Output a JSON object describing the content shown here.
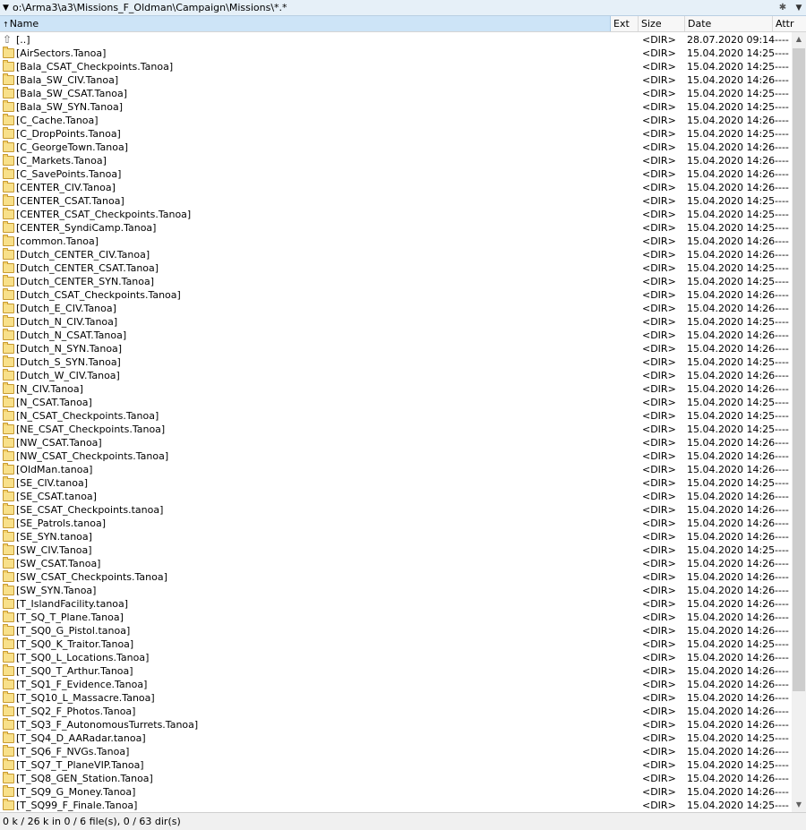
{
  "path_bar": {
    "path": "o:\\Arma3\\a3\\Missions_F_Oldman\\Campaign\\Missions\\*.*",
    "dropdown_icon": "triangle-down",
    "favorites_icon": "star",
    "history_icon": "chevron-down"
  },
  "columns": {
    "name": "Name",
    "ext": "Ext",
    "size": "Size",
    "date": "Date",
    "attr": "Attr",
    "sort_icon": "sort-arrow-up"
  },
  "colors": {
    "path_bar_bg": "#e6f0f8",
    "sorted_header_bg": "#cde4f7",
    "folder_fill": "#f8e08a"
  },
  "files": [
    {
      "name": "[..]",
      "size": "<DIR>",
      "date": "28.07.2020 09:14",
      "attr": "----",
      "icon": "up-dir"
    },
    {
      "name": "[AirSectors.Tanoa]",
      "size": "<DIR>",
      "date": "15.04.2020 14:25",
      "attr": "----",
      "icon": "folder"
    },
    {
      "name": "[Bala_CSAT_Checkpoints.Tanoa]",
      "size": "<DIR>",
      "date": "15.04.2020 14:25",
      "attr": "----",
      "icon": "folder"
    },
    {
      "name": "[Bala_SW_CIV.Tanoa]",
      "size": "<DIR>",
      "date": "15.04.2020 14:26",
      "attr": "----",
      "icon": "folder"
    },
    {
      "name": "[Bala_SW_CSAT.Tanoa]",
      "size": "<DIR>",
      "date": "15.04.2020 14:25",
      "attr": "----",
      "icon": "folder"
    },
    {
      "name": "[Bala_SW_SYN.Tanoa]",
      "size": "<DIR>",
      "date": "15.04.2020 14:25",
      "attr": "----",
      "icon": "folder"
    },
    {
      "name": "[C_Cache.Tanoa]",
      "size": "<DIR>",
      "date": "15.04.2020 14:26",
      "attr": "----",
      "icon": "folder"
    },
    {
      "name": "[C_DropPoints.Tanoa]",
      "size": "<DIR>",
      "date": "15.04.2020 14:25",
      "attr": "----",
      "icon": "folder"
    },
    {
      "name": "[C_GeorgeTown.Tanoa]",
      "size": "<DIR>",
      "date": "15.04.2020 14:26",
      "attr": "----",
      "icon": "folder"
    },
    {
      "name": "[C_Markets.Tanoa]",
      "size": "<DIR>",
      "date": "15.04.2020 14:26",
      "attr": "----",
      "icon": "folder"
    },
    {
      "name": "[C_SavePoints.Tanoa]",
      "size": "<DIR>",
      "date": "15.04.2020 14:26",
      "attr": "----",
      "icon": "folder"
    },
    {
      "name": "[CENTER_CIV.Tanoa]",
      "size": "<DIR>",
      "date": "15.04.2020 14:26",
      "attr": "----",
      "icon": "folder"
    },
    {
      "name": "[CENTER_CSAT.Tanoa]",
      "size": "<DIR>",
      "date": "15.04.2020 14:25",
      "attr": "----",
      "icon": "folder"
    },
    {
      "name": "[CENTER_CSAT_Checkpoints.Tanoa]",
      "size": "<DIR>",
      "date": "15.04.2020 14:25",
      "attr": "----",
      "icon": "folder"
    },
    {
      "name": "[CENTER_SyndiCamp.Tanoa]",
      "size": "<DIR>",
      "date": "15.04.2020 14:25",
      "attr": "----",
      "icon": "folder"
    },
    {
      "name": "[common.Tanoa]",
      "size": "<DIR>",
      "date": "15.04.2020 14:26",
      "attr": "----",
      "icon": "folder"
    },
    {
      "name": "[Dutch_CENTER_CIV.Tanoa]",
      "size": "<DIR>",
      "date": "15.04.2020 14:26",
      "attr": "----",
      "icon": "folder"
    },
    {
      "name": "[Dutch_CENTER_CSAT.Tanoa]",
      "size": "<DIR>",
      "date": "15.04.2020 14:25",
      "attr": "----",
      "icon": "folder"
    },
    {
      "name": "[Dutch_CENTER_SYN.Tanoa]",
      "size": "<DIR>",
      "date": "15.04.2020 14:25",
      "attr": "----",
      "icon": "folder"
    },
    {
      "name": "[Dutch_CSAT_Checkpoints.Tanoa]",
      "size": "<DIR>",
      "date": "15.04.2020 14:26",
      "attr": "----",
      "icon": "folder"
    },
    {
      "name": "[Dutch_E_CIV.Tanoa]",
      "size": "<DIR>",
      "date": "15.04.2020 14:26",
      "attr": "----",
      "icon": "folder"
    },
    {
      "name": "[Dutch_N_CIV.Tanoa]",
      "size": "<DIR>",
      "date": "15.04.2020 14:25",
      "attr": "----",
      "icon": "folder"
    },
    {
      "name": "[Dutch_N_CSAT.Tanoa]",
      "size": "<DIR>",
      "date": "15.04.2020 14:26",
      "attr": "----",
      "icon": "folder"
    },
    {
      "name": "[Dutch_N_SYN.Tanoa]",
      "size": "<DIR>",
      "date": "15.04.2020 14:26",
      "attr": "----",
      "icon": "folder"
    },
    {
      "name": "[Dutch_S_SYN.Tanoa]",
      "size": "<DIR>",
      "date": "15.04.2020 14:25",
      "attr": "----",
      "icon": "folder"
    },
    {
      "name": "[Dutch_W_CIV.Tanoa]",
      "size": "<DIR>",
      "date": "15.04.2020 14:26",
      "attr": "----",
      "icon": "folder"
    },
    {
      "name": "[N_CIV.Tanoa]",
      "size": "<DIR>",
      "date": "15.04.2020 14:26",
      "attr": "----",
      "icon": "folder"
    },
    {
      "name": "[N_CSAT.Tanoa]",
      "size": "<DIR>",
      "date": "15.04.2020 14:25",
      "attr": "----",
      "icon": "folder"
    },
    {
      "name": "[N_CSAT_Checkpoints.Tanoa]",
      "size": "<DIR>",
      "date": "15.04.2020 14:25",
      "attr": "----",
      "icon": "folder"
    },
    {
      "name": "[NE_CSAT_Checkpoints.Tanoa]",
      "size": "<DIR>",
      "date": "15.04.2020 14:25",
      "attr": "----",
      "icon": "folder"
    },
    {
      "name": "[NW_CSAT.Tanoa]",
      "size": "<DIR>",
      "date": "15.04.2020 14:26",
      "attr": "----",
      "icon": "folder"
    },
    {
      "name": "[NW_CSAT_Checkpoints.Tanoa]",
      "size": "<DIR>",
      "date": "15.04.2020 14:26",
      "attr": "----",
      "icon": "folder"
    },
    {
      "name": "[OldMan.tanoa]",
      "size": "<DIR>",
      "date": "15.04.2020 14:26",
      "attr": "----",
      "icon": "folder"
    },
    {
      "name": "[SE_CIV.tanoa]",
      "size": "<DIR>",
      "date": "15.04.2020 14:25",
      "attr": "----",
      "icon": "folder"
    },
    {
      "name": "[SE_CSAT.tanoa]",
      "size": "<DIR>",
      "date": "15.04.2020 14:26",
      "attr": "----",
      "icon": "folder"
    },
    {
      "name": "[SE_CSAT_Checkpoints.tanoa]",
      "size": "<DIR>",
      "date": "15.04.2020 14:26",
      "attr": "----",
      "icon": "folder"
    },
    {
      "name": "[SE_Patrols.tanoa]",
      "size": "<DIR>",
      "date": "15.04.2020 14:26",
      "attr": "----",
      "icon": "folder"
    },
    {
      "name": "[SE_SYN.tanoa]",
      "size": "<DIR>",
      "date": "15.04.2020 14:26",
      "attr": "----",
      "icon": "folder"
    },
    {
      "name": "[SW_CIV.Tanoa]",
      "size": "<DIR>",
      "date": "15.04.2020 14:25",
      "attr": "----",
      "icon": "folder"
    },
    {
      "name": "[SW_CSAT.Tanoa]",
      "size": "<DIR>",
      "date": "15.04.2020 14:26",
      "attr": "----",
      "icon": "folder"
    },
    {
      "name": "[SW_CSAT_Checkpoints.Tanoa]",
      "size": "<DIR>",
      "date": "15.04.2020 14:26",
      "attr": "----",
      "icon": "folder"
    },
    {
      "name": "[SW_SYN.Tanoa]",
      "size": "<DIR>",
      "date": "15.04.2020 14:26",
      "attr": "----",
      "icon": "folder"
    },
    {
      "name": "[T_IslandFacility.tanoa]",
      "size": "<DIR>",
      "date": "15.04.2020 14:26",
      "attr": "----",
      "icon": "folder"
    },
    {
      "name": "[T_SQ_T_Plane.Tanoa]",
      "size": "<DIR>",
      "date": "15.04.2020 14:26",
      "attr": "----",
      "icon": "folder"
    },
    {
      "name": "[T_SQ0_G_Pistol.tanoa]",
      "size": "<DIR>",
      "date": "15.04.2020 14:26",
      "attr": "----",
      "icon": "folder"
    },
    {
      "name": "[T_SQ0_K_Traitor.Tanoa]",
      "size": "<DIR>",
      "date": "15.04.2020 14:25",
      "attr": "----",
      "icon": "folder"
    },
    {
      "name": "[T_SQ0_L_Locations.Tanoa]",
      "size": "<DIR>",
      "date": "15.04.2020 14:26",
      "attr": "----",
      "icon": "folder"
    },
    {
      "name": "[T_SQ0_T_Arthur.Tanoa]",
      "size": "<DIR>",
      "date": "15.04.2020 14:26",
      "attr": "----",
      "icon": "folder"
    },
    {
      "name": "[T_SQ1_F_Evidence.Tanoa]",
      "size": "<DIR>",
      "date": "15.04.2020 14:26",
      "attr": "----",
      "icon": "folder"
    },
    {
      "name": "[T_SQ10_L_Massacre.Tanoa]",
      "size": "<DIR>",
      "date": "15.04.2020 14:26",
      "attr": "----",
      "icon": "folder"
    },
    {
      "name": "[T_SQ2_F_Photos.Tanoa]",
      "size": "<DIR>",
      "date": "15.04.2020 14:26",
      "attr": "----",
      "icon": "folder"
    },
    {
      "name": "[T_SQ3_F_AutonomousTurrets.Tanoa]",
      "size": "<DIR>",
      "date": "15.04.2020 14:26",
      "attr": "----",
      "icon": "folder"
    },
    {
      "name": "[T_SQ4_D_AARadar.tanoa]",
      "size": "<DIR>",
      "date": "15.04.2020 14:25",
      "attr": "----",
      "icon": "folder"
    },
    {
      "name": "[T_SQ6_F_NVGs.Tanoa]",
      "size": "<DIR>",
      "date": "15.04.2020 14:26",
      "attr": "----",
      "icon": "folder"
    },
    {
      "name": "[T_SQ7_T_PlaneVIP.Tanoa]",
      "size": "<DIR>",
      "date": "15.04.2020 14:25",
      "attr": "----",
      "icon": "folder"
    },
    {
      "name": "[T_SQ8_GEN_Station.Tanoa]",
      "size": "<DIR>",
      "date": "15.04.2020 14:26",
      "attr": "----",
      "icon": "folder"
    },
    {
      "name": "[T_SQ9_G_Money.Tanoa]",
      "size": "<DIR>",
      "date": "15.04.2020 14:26",
      "attr": "----",
      "icon": "folder"
    },
    {
      "name": "[T_SQ99_F_Finale.Tanoa]",
      "size": "<DIR>",
      "date": "15.04.2020 14:25",
      "attr": "----",
      "icon": "folder"
    }
  ],
  "scrollbar": {
    "up_icon": "triangle-up",
    "down_icon": "triangle-down"
  },
  "status_bar": {
    "text": "0 k / 26 k in 0 / 6 file(s), 0 / 63 dir(s)"
  }
}
